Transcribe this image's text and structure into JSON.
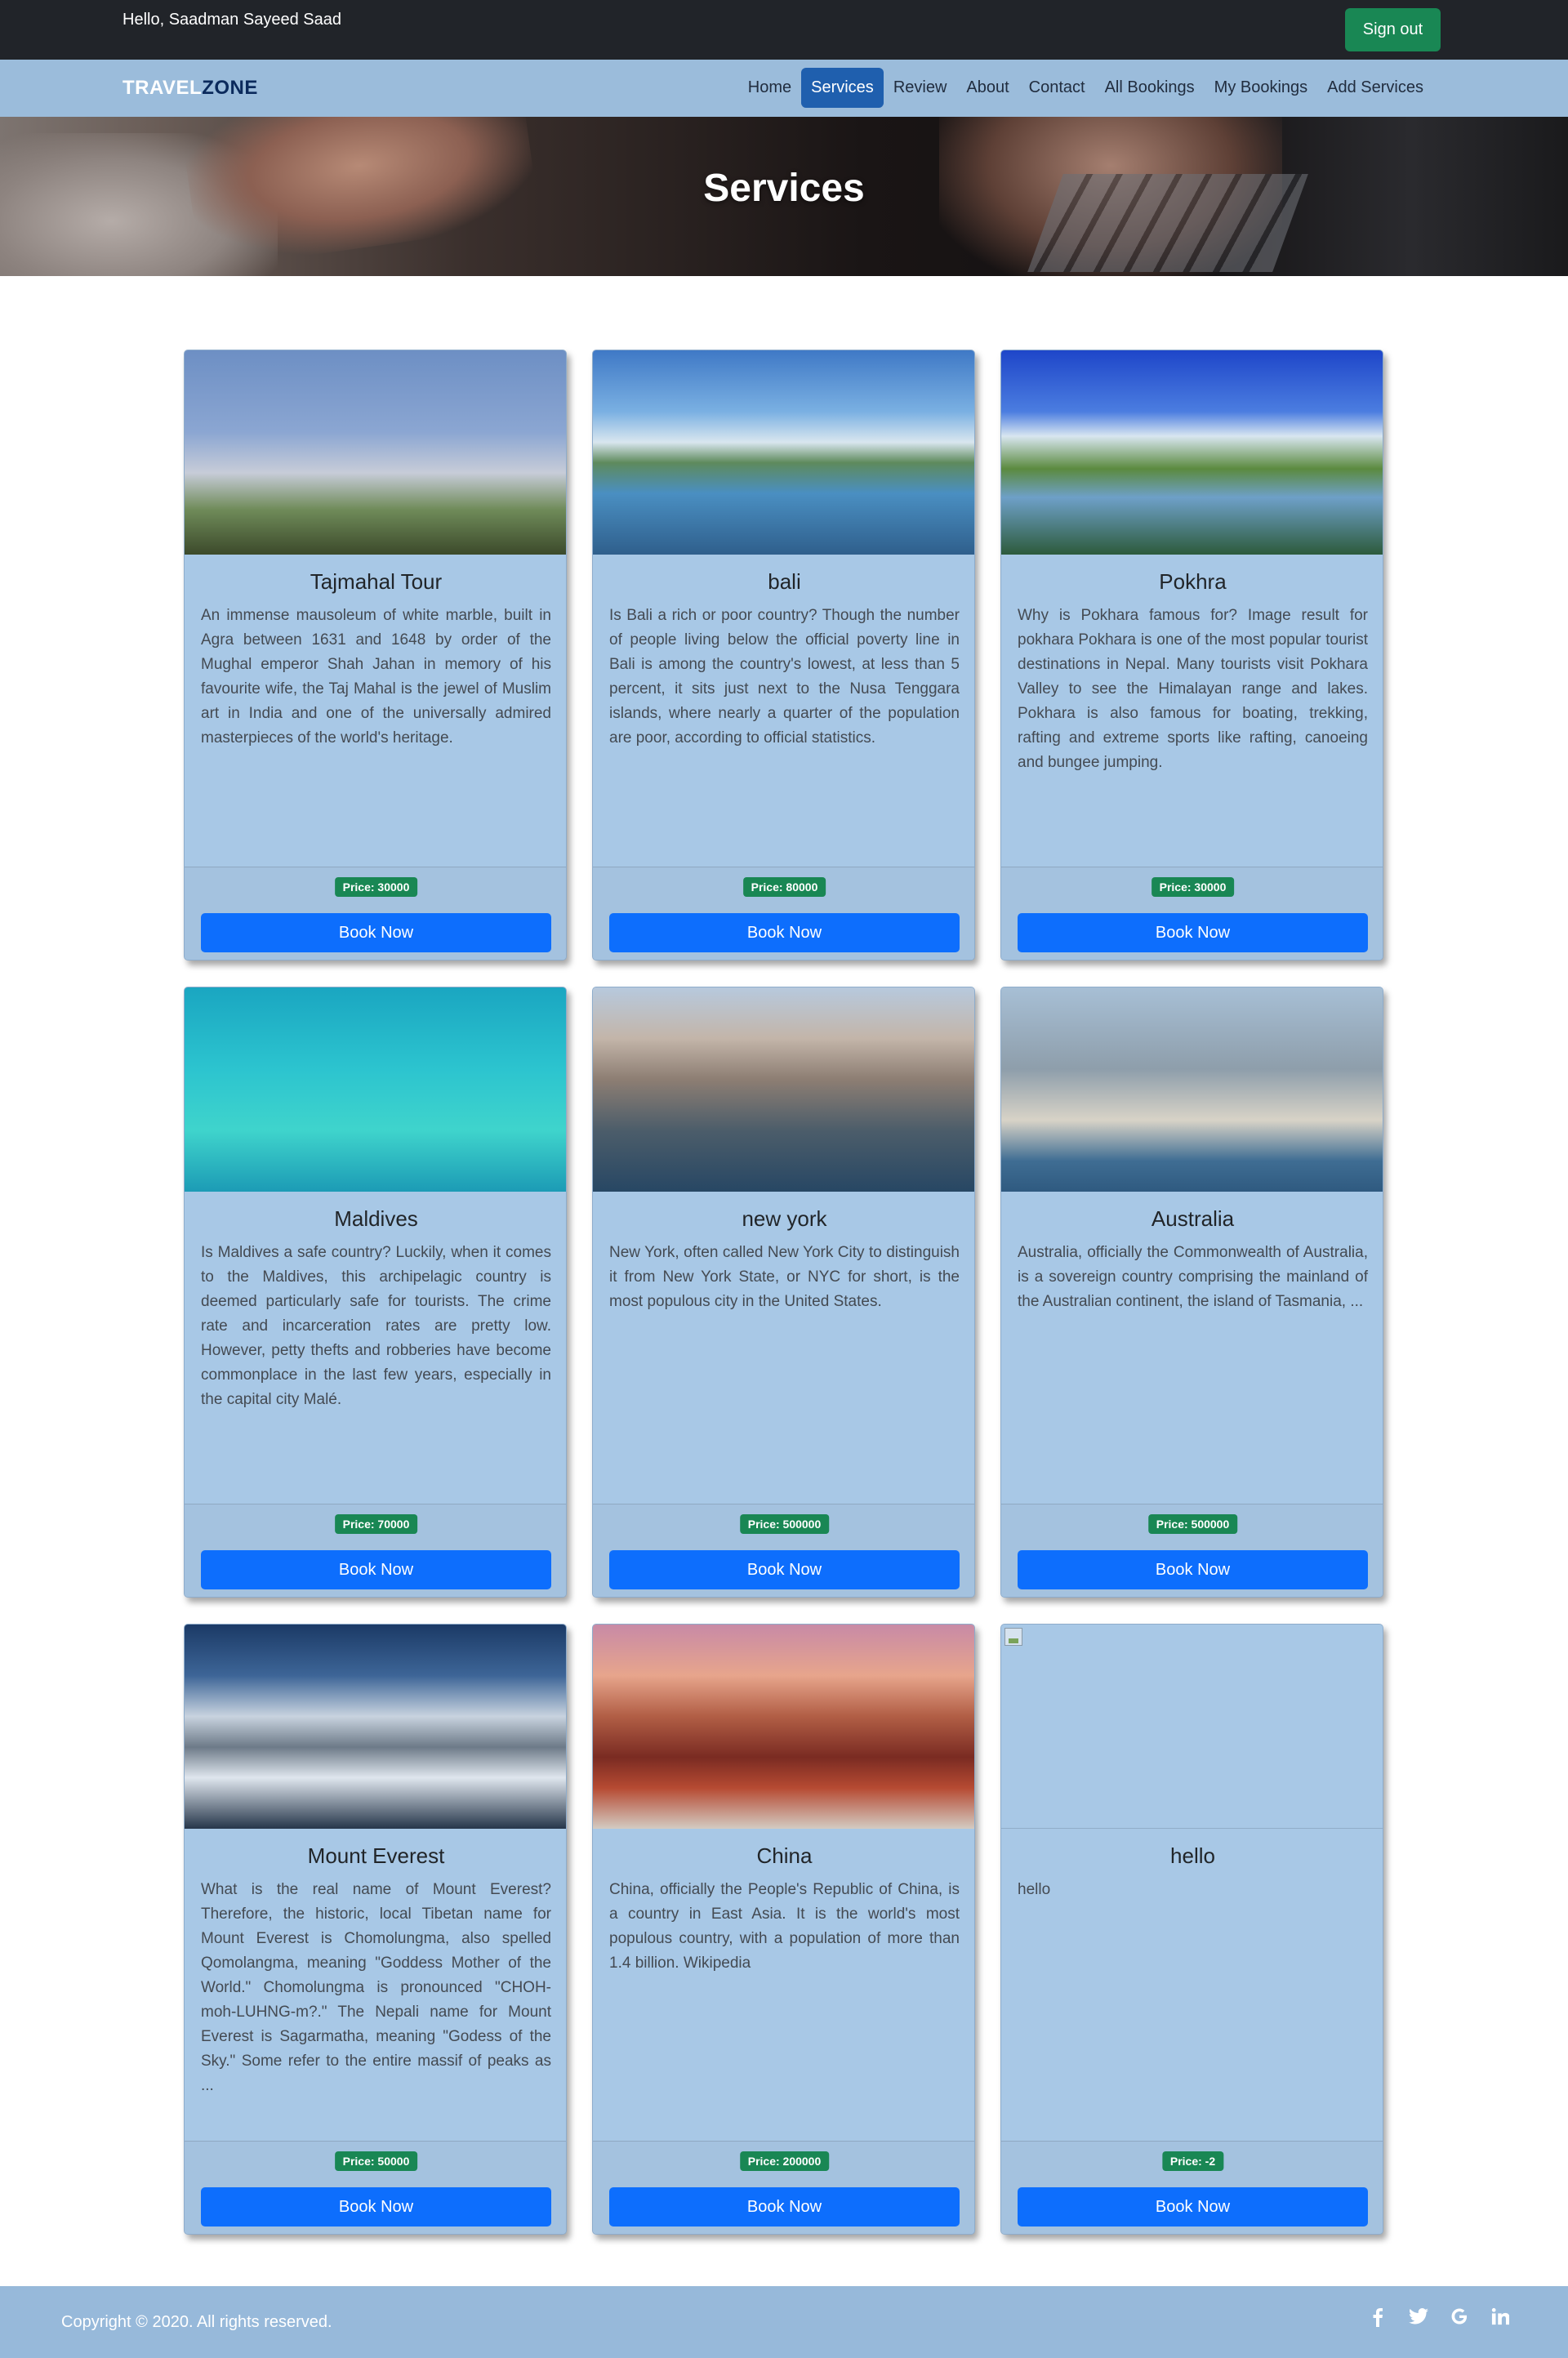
{
  "topbar": {
    "greeting": "Hello, Saadman Sayeed Saad",
    "signout_label": "Sign out"
  },
  "brand": {
    "part1": "TRAVEL",
    "part2": "ZONE"
  },
  "nav": [
    {
      "label": "Home",
      "active": false
    },
    {
      "label": "Services",
      "active": true
    },
    {
      "label": "Review",
      "active": false
    },
    {
      "label": "About",
      "active": false
    },
    {
      "label": "Contact",
      "active": false
    },
    {
      "label": "All Bookings",
      "active": false
    },
    {
      "label": "My Bookings",
      "active": false
    },
    {
      "label": "Add Services",
      "active": false
    }
  ],
  "hero": {
    "title": "Services"
  },
  "cards": [
    {
      "title": "Tajmahal Tour",
      "description": "An immense mausoleum of white marble, built in Agra between 1631 and 1648 by order of the Mughal emperor Shah Jahan in memory of his favourite wife, the Taj Mahal is the jewel of Muslim art in India and one of the universally admired masterpieces of the world's heritage.",
      "price": "Price: 30000",
      "book_label": "Book Now"
    },
    {
      "title": "bali",
      "description": "Is Bali a rich or poor country? Though the number of people living below the official poverty line in Bali is among the country's lowest, at less than 5 percent, it sits just next to the Nusa Tenggara islands, where nearly a quarter of the population are poor, according to official statistics.",
      "price": "Price: 80000",
      "book_label": "Book Now"
    },
    {
      "title": "Pokhra",
      "description": "Why is Pokhara famous for? Image result for pokhara Pokhara is one of the most popular tourist destinations in Nepal. Many tourists visit Pokhara Valley to see the Himalayan range and lakes. Pokhara is also famous for boating, trekking, rafting and extreme sports like rafting, canoeing and bungee jumping.",
      "price": "Price: 30000",
      "book_label": "Book Now"
    },
    {
      "title": "Maldives",
      "description": "Is Maldives a safe country? Luckily, when it comes to the Maldives, this archipelagic country is deemed particularly safe for tourists. The crime rate and incarceration rates are pretty low. However, petty thefts and robberies have become commonplace in the last few years, especially in the capital city Malé.",
      "price": "Price: 70000",
      "book_label": "Book Now"
    },
    {
      "title": "new york",
      "description": "New York, often called New York City to distinguish it from New York State, or NYC for short, is the most populous city in the United States.",
      "price": "Price: 500000",
      "book_label": "Book Now"
    },
    {
      "title": "Australia",
      "description": "Australia, officially the Commonwealth of Australia, is a sovereign country comprising the mainland of the Australian continent, the island of Tasmania, ...",
      "price": "Price: 500000",
      "book_label": "Book Now"
    },
    {
      "title": "Mount Everest",
      "description": "What is the real name of Mount Everest? Therefore, the historic, local Tibetan name for Mount Everest is Chomolungma, also spelled Qomolangma, meaning \"Goddess Mother of the World.\" Chomolungma is pronounced \"CHOH-moh-LUHNG-m?.\" The Nepali name for Mount Everest is Sagarmatha, meaning \"Godess of the Sky.\" Some refer to the entire massif of peaks as ...",
      "price": "Price: 50000",
      "book_label": "Book Now"
    },
    {
      "title": "China",
      "description": "China, officially the People's Republic of China, is a country in East Asia. It is the world's most populous country, with a population of more than 1.4 billion. Wikipedia",
      "price": "Price: 200000",
      "book_label": "Book Now"
    },
    {
      "title": "hello",
      "description": "hello",
      "price": "Price: -2",
      "book_label": "Book Now"
    }
  ],
  "footer": {
    "copyright": "Copyright © 2020. All rights reserved."
  },
  "colors": {
    "topbar": "#212429",
    "navbar": "#9bbcdb",
    "card": "#a8c8e6",
    "primary": "#0d6efd",
    "success": "#198754",
    "footer": "#97b9da"
  }
}
